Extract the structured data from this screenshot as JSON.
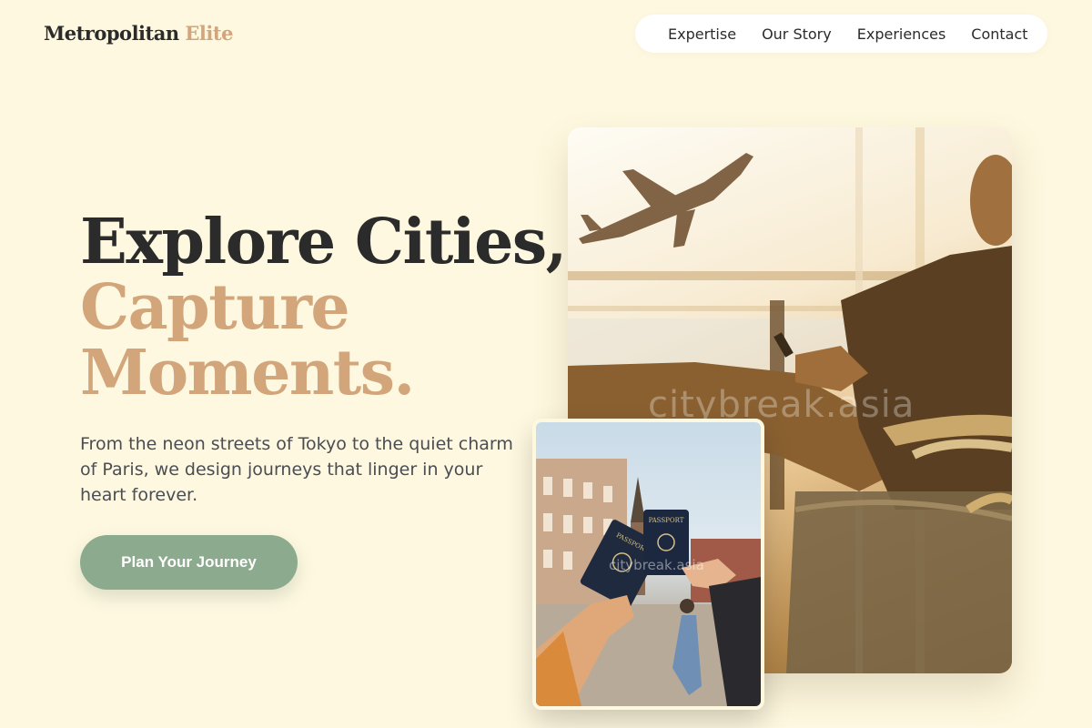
{
  "brand": {
    "name_main": "Metropolitan",
    "name_accent": "Elite"
  },
  "nav": {
    "items": [
      "Expertise",
      "Our Story",
      "Experiences",
      "Contact"
    ]
  },
  "hero": {
    "headline_line1": "Explore Cities,",
    "headline_line2": "Capture",
    "headline_line3": "Moments.",
    "subtext": "From the neon streets of Tokyo to the quiet charm of Paris, we design journeys that linger in your heart forever.",
    "cta_label": "Plan Your Journey"
  },
  "images": {
    "main_watermark": "citybreak.asia",
    "inset_watermark": "citybreak.asia",
    "passport_label": "PASSPORT"
  },
  "colors": {
    "background": "#fef8e0",
    "accent": "#d2a57a",
    "cta": "#8caa8e",
    "text_dark": "#2b2b2b"
  }
}
